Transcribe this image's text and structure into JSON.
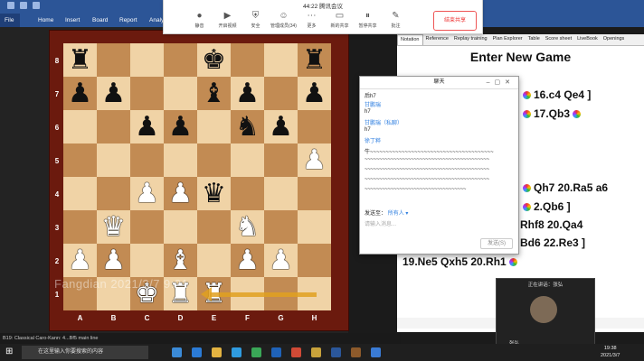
{
  "ribbon": {
    "menus": [
      "File",
      "Home",
      "Insert",
      "Board",
      "Report",
      "Analysis"
    ]
  },
  "meeting": {
    "timer": "44:22",
    "app_name": "腾讯会议",
    "tools": [
      {
        "icon": "microphone-icon",
        "glyph": "🎙",
        "label": "静音"
      },
      {
        "icon": "camera-icon",
        "glyph": "▶",
        "label": "开启视频"
      },
      {
        "icon": "shield-icon",
        "glyph": "⛨",
        "label": "安全"
      },
      {
        "icon": "people-icon",
        "glyph": "👥",
        "label": "管理成员(34)"
      },
      {
        "icon": "more-icon",
        "glyph": "⋯",
        "label": "更多"
      },
      {
        "icon": "share-screen-icon",
        "glyph": "▭",
        "label": "新的共享"
      },
      {
        "icon": "pause-share-icon",
        "glyph": "⏸",
        "label": "暂停共享"
      },
      {
        "icon": "annotate-icon",
        "glyph": "✎",
        "label": "批注"
      }
    ],
    "end_share": "结束共享"
  },
  "board": {
    "ranks": [
      "8",
      "7",
      "6",
      "5",
      "4",
      "3",
      "2",
      "1"
    ],
    "files": [
      "A",
      "B",
      "C",
      "D",
      "E",
      "F",
      "G",
      "H"
    ],
    "position": [
      [
        "bR",
        "",
        "",
        "",
        "bK",
        "",
        "",
        "bR"
      ],
      [
        "bP",
        "bP",
        "",
        "",
        "bB",
        "bP",
        "",
        "bP"
      ],
      [
        "",
        "",
        "bP",
        "bP",
        "",
        "bN",
        "bP",
        ""
      ],
      [
        "",
        "",
        "",
        "",
        "",
        "",
        "",
        "wP"
      ],
      [
        "",
        "",
        "wP",
        "wP",
        "bQ",
        "",
        "",
        ""
      ],
      [
        "",
        "wQ",
        "",
        "",
        "",
        "wN",
        "",
        ""
      ],
      [
        "wP",
        "wP",
        "",
        "wB",
        "",
        "wP",
        "wP",
        ""
      ],
      [
        "",
        "",
        "wK",
        "wR",
        "wR",
        "",
        "",
        ""
      ]
    ],
    "watermark": "Fangdian 2021/3/7 9:21",
    "status": "B19: Classical Caro-Kann: 4...Bf5 main line"
  },
  "right_pane": {
    "tabs": [
      "Notation",
      "Reference",
      "Replay training",
      "Plan Explorer",
      "Table",
      "Score sheet",
      "LiveBook",
      "Openings"
    ],
    "title": "Enter New Game",
    "moves": [
      {
        "text": "16.c4  Qe4 ]"
      },
      {
        "text": "17.Qb3"
      },
      {
        "text": "Qh7  20.Ra5  a6"
      },
      {
        "text": "2.Qb6  ]"
      },
      {
        "text": "Rhf8  20.Qa4"
      },
      {
        "text": "Bd6  22.Re3  ]"
      },
      {
        "text": "19.Ne5  Qxh5  20.Rh1"
      }
    ]
  },
  "chat": {
    "title": "聊天",
    "lines": [
      {
        "text": "后h7",
        "cls": ""
      },
      {
        "text": "甘鹏瑞",
        "cls": "blue"
      },
      {
        "text": "h7",
        "cls": ""
      },
      {
        "text": "甘鹏瑞（私聊）",
        "cls": "blue"
      },
      {
        "text": "h7",
        "cls": ""
      },
      {
        "text": "徐丁粹",
        "cls": "blue"
      },
      {
        "text": "牛~~~~~~~~~~~~~~~~~~~~~~~~~~~~~~~~~~~~~~~",
        "cls": ""
      }
    ],
    "waves": [
      "~~~~~~~~~~~~~~~~~~~~~~~~~~~~~~~~~~~~~~~~~~~",
      "~~~~~~~~~~~~~~~~~~~~~~~~~~~~~~~~~~~~~~~~~~~",
      "~~~~~~~~~~~~~~~~~~~~~~~~~~~~~~~~~~~~~~~~~~~",
      "~~~~~~~~~~~~~~~~~~~~~~~~~~~~~~~~~~~"
    ],
    "send_to_label": "发送至：",
    "send_to_value": "所有人 ▾",
    "input_placeholder": "请输入消息...",
    "send_button": "发送(S)"
  },
  "video": {
    "caption": "正在讲话：张弘",
    "name": "张弘"
  },
  "taskbar": {
    "search_placeholder": "在这里输入你要搜索的内容",
    "time": "19:38",
    "date": "2021/3/7"
  }
}
